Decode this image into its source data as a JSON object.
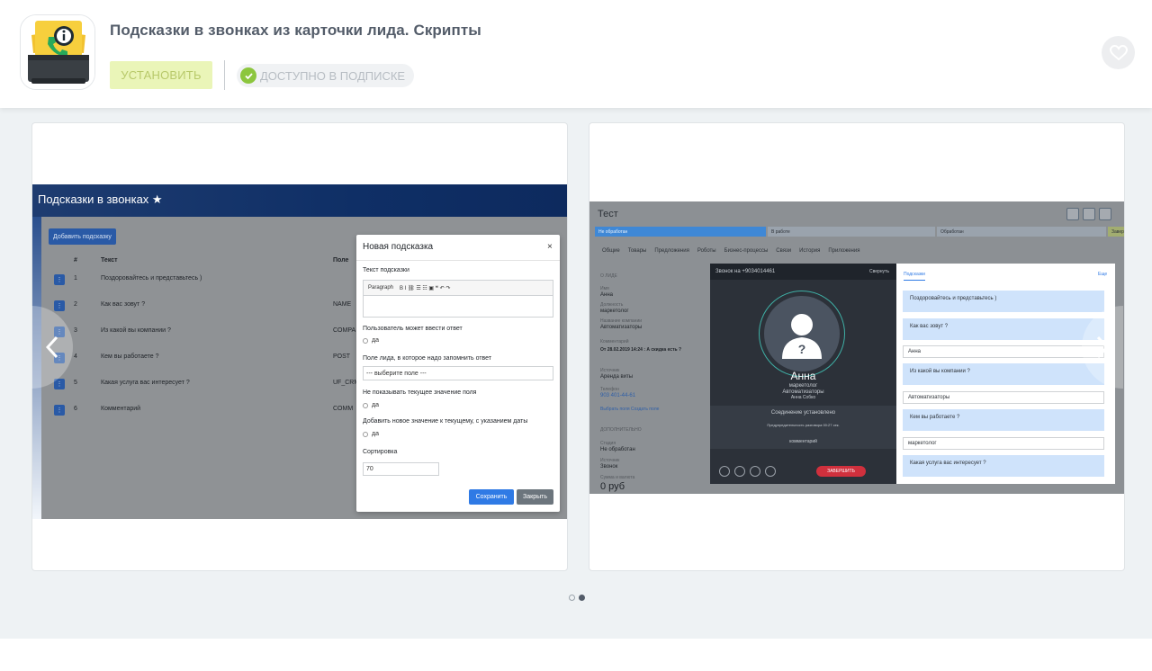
{
  "header": {
    "title": "Подсказки в звонках из карточки лида. Скрипты",
    "install_label": "УСТАНОВИТЬ",
    "subscription_label": "ДОСТУПНО В ПОДПИСКЕ"
  },
  "gallery": {
    "active_slide": 2,
    "slide_count": 2,
    "slide1": {
      "bar_title": "Подсказки в звонках ★",
      "add_button": "Добавить подсказку",
      "columns": [
        "#",
        "Текст",
        "Поле"
      ],
      "rows": [
        {
          "n": "1",
          "text": "Поздоровайтесь и представьтесь )",
          "field": ""
        },
        {
          "n": "2",
          "text": "Как вас зовут ?",
          "field": "NAME"
        },
        {
          "n": "3",
          "text": "Из какой вы компании ?",
          "field": "COMPA"
        },
        {
          "n": "4",
          "text": "Кем вы работаете ?",
          "field": "POST"
        },
        {
          "n": "5",
          "text": "Какая услуга вас интересует ?",
          "field": "UF_CRM"
        },
        {
          "n": "6",
          "text": "Комментарий",
          "field": "COMM"
        }
      ],
      "modal": {
        "title": "Новая подсказка",
        "close": "×",
        "text_label": "Текст подсказки",
        "toolbar_format": "Paragraph",
        "toolbar_tools": "B  I  ⛓  ☰  ☷  ▣  ❝  ↶  ↷",
        "user_can_answer": "Пользователь может ввести ответ",
        "yes": "да",
        "lead_field_label": "Поле лида, в которое надо запомнить ответ",
        "select_placeholder": "--- выберите поле ---",
        "hide_current": "Не показывать текущее значение поля",
        "append_new": "Добавить новое значение к текущему, с указанием даты",
        "sort_label": "Сортировка",
        "sort_value": "70",
        "save": "Сохранить",
        "cancel": "Закрыть"
      }
    },
    "slide2": {
      "title": "Тест",
      "stages": [
        "Не обработан",
        "В работе",
        "Обработан",
        "Завер"
      ],
      "tabs": [
        "Общие",
        "Товары",
        "Предложения",
        "Роботы",
        "Бизнес-процессы",
        "Связи",
        "История",
        "Приложения"
      ],
      "left": {
        "section": "О ЛИДЕ",
        "name_label": "Имя",
        "name_value": "Анна",
        "post_label": "Должность",
        "post_value": "маркетолог",
        "company_label": "Название компании",
        "company_value": "Автоматизаторы",
        "comment_label": "Комментарий",
        "comment_value": "От 28.02.2019 14:24 : А скидка есть ?",
        "source_label": "Источник",
        "source_value": "Аренда виты",
        "phone_label": "Телефон",
        "phone_value": "903 401-44-61",
        "links": "Выбрать поля   Создать поле",
        "extra": "ДОПОЛНИТЕЛЬНО",
        "status_label": "Стадия",
        "status_value": "Не обработан",
        "source2_label": "Источник",
        "source2_value": "Звонок",
        "sum_label": "Сумма и валюта",
        "sum_value": "0 руб"
      },
      "call": {
        "header": "Звонок на +9034014461",
        "minimize": "Свернуть",
        "name": "Анна",
        "role": "маркетолог",
        "company": "Автоматизаторы",
        "operator": "Анна Собко",
        "status": "Соединение установлено",
        "recording": "Предупредительность разговора 00:27 сек.",
        "comment": "комментарий",
        "end": "ЗАВЕРШИТЬ"
      },
      "panel": {
        "tab": "Подсказки",
        "more": "Еще",
        "items": [
          {
            "q": "Поздоровайтесь и представьтесь )",
            "a": ""
          },
          {
            "q": "Как вас зовут ?",
            "a": "Анна"
          },
          {
            "q": "Из какой вы компании ?",
            "a": "Автоматизаторы"
          },
          {
            "q": "Кем вы работаете ?",
            "a": "маркетолог"
          },
          {
            "q": "Какая услуга вас интересует ?",
            "a": ""
          }
        ]
      }
    }
  }
}
